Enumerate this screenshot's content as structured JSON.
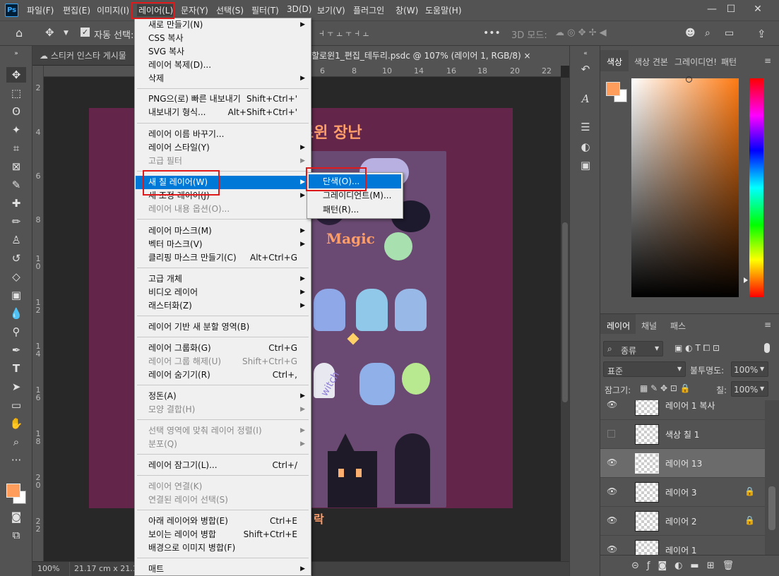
{
  "app": {
    "logo": "Ps"
  },
  "menubar": {
    "items": [
      "파일(F)",
      "편집(E)",
      "이미지(I)",
      "레이어(L)",
      "문자(Y)",
      "선택(S)",
      "필터(T)",
      "3D(D)",
      "보기(V)",
      "플러그인",
      "창(W)",
      "도움말(H)"
    ],
    "active": "레이어(L)"
  },
  "window": {
    "minimize": "—",
    "maximize": "☐",
    "close": "✕"
  },
  "options": {
    "auto_select": "자동 선택:",
    "mode3d": "3D 모드:"
  },
  "tabs": {
    "cloud_doc": "스티커 인스타 게시물",
    "current_doc": "할로윈1_편집_테두리.psdc @ 107% (레이어 1, RGB/8)",
    "close": "×"
  },
  "ruler": {
    "h": [
      "6",
      "8",
      "10",
      "12",
      "14",
      "16",
      "18",
      "20",
      "22"
    ],
    "v": [
      "2",
      "4",
      "6",
      "8",
      "1\n0",
      "1\n2",
      "1\n4",
      "1\n6",
      "1\n8",
      "2\n0",
      "2\n2"
    ]
  },
  "artwork": {
    "title": "로윈 장난",
    "bottom": "락",
    "magic": "Magic",
    "witch": "witch"
  },
  "status": {
    "zoom": "100%",
    "size": "21.17 cm x 21.17"
  },
  "menu": {
    "new": "새로 만들기(N)",
    "css": "CSS 복사",
    "svg": "SVG 복사",
    "dup": "레이어 복제(D)...",
    "del": "삭제",
    "png": "PNG으(로) 빠른 내보내기",
    "png_sc": "Shift+Ctrl+'",
    "exportas": "내보내기 형식...",
    "exportas_sc": "Alt+Shift+Ctrl+'",
    "rename": "레이어 이름 바꾸기...",
    "style": "레이어 스타일(Y)",
    "smartfilter": "고급 필터",
    "fill": "새 칠 레이어(W)",
    "adjust": "새 조정 레이어(J)",
    "content": "레이어 내용 옵션(O)...",
    "mask": "레이어 마스크(M)",
    "vmask": "벡터 마스크(V)",
    "clip": "클리핑 마스크 만들기(C)",
    "clip_sc": "Alt+Ctrl+G",
    "smartobj": "고급 개체",
    "video": "비디오 레이어",
    "raster": "래스터화(Z)",
    "slice": "레이어 기반 새 분할 영역(B)",
    "group": "레이어 그룹화(G)",
    "group_sc": "Ctrl+G",
    "ungroup": "레이어 그룹 해제(U)",
    "ungroup_sc": "Shift+Ctrl+G",
    "hide": "레이어 숨기기(R)",
    "hide_sc": "Ctrl+,",
    "arrange": "정돈(A)",
    "combine": "모양 결합(H)",
    "align": "선택 영역에 맞춰 레이어 정렬(I)",
    "distribute": "분포(Q)",
    "lock": "레이어 잠그기(L)...",
    "lock_sc": "Ctrl+/",
    "link": "레이어 연결(K)",
    "selectlinked": "연결된 레이어 선택(S)",
    "mergedown": "아래 레이어와 병합(E)",
    "mergedown_sc": "Ctrl+E",
    "mergevisible": "보이는 레이어 병합",
    "mergevisible_sc": "Shift+Ctrl+E",
    "flatten": "배경으로 이미지 병합(F)",
    "matting": "매트"
  },
  "submenu": {
    "solid": "단색(O)...",
    "gradient": "그레이디언트(M)...",
    "pattern": "패턴(R)..."
  },
  "colorpanel": {
    "tabs": [
      "색상",
      "색상 견본",
      "그레이디언!",
      "패턴"
    ],
    "fg": "#ff9d5c",
    "bg": "#ffffff"
  },
  "layerspanel": {
    "tabs": [
      "레이어",
      "채널",
      "패스"
    ],
    "kind": "종류",
    "blend": "표준",
    "opacity_label": "불투명도:",
    "opacity": "100%",
    "lock_label": "잠그기:",
    "fill_label": "칠:",
    "fill": "100%",
    "layers": [
      {
        "name": "레이어 1 복사",
        "visible": true
      },
      {
        "name": "색상 칠 1",
        "visible": false
      },
      {
        "name": "레이어 13",
        "visible": true,
        "selected": true
      },
      {
        "name": "레이어 3",
        "visible": true,
        "locked": true
      },
      {
        "name": "레이어 2",
        "visible": true,
        "locked": true
      },
      {
        "name": "레이어 1",
        "visible": true
      }
    ]
  }
}
